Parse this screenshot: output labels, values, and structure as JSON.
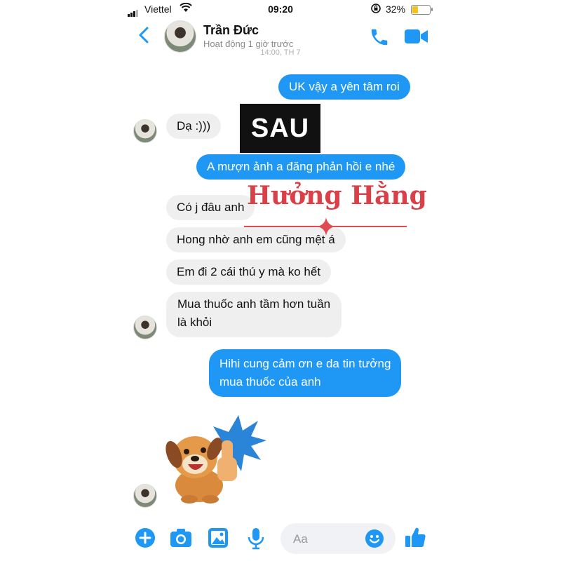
{
  "status_bar": {
    "carrier": "Viettel",
    "time": "09:20",
    "battery": "32%"
  },
  "header": {
    "contact_name": "Trần Đức",
    "contact_status": "Hoạt động 1 giờ trước",
    "timestamp": "14:00, TH 7"
  },
  "messages": [
    {
      "from": "me",
      "text": "UK vậy a yên tâm roi"
    },
    {
      "from": "them",
      "text": "Dạ :)))"
    },
    {
      "from": "me",
      "text": "A mượn ảnh a đăng phản hồi e nhé"
    },
    {
      "from": "them",
      "text": "Có j đâu anh"
    },
    {
      "from": "them",
      "text": "Hong nhờ anh em cũng mệt á"
    },
    {
      "from": "them",
      "text": "Em đi 2 cái thú y mà ko hết"
    },
    {
      "from": "them",
      "line1": "Mua thuốc anh tầm hơn tuần",
      "line2": "là khỏi"
    },
    {
      "from": "me",
      "line1": "Hihi cung cảm ơn e da tin tưởng",
      "line2": "mua thuốc của anh"
    }
  ],
  "overlay": {
    "label": "SAU",
    "watermark": "Hưởng Hằng"
  },
  "composer": {
    "placeholder": "Aa"
  },
  "colors": {
    "accent": "#1e97f5",
    "incoming": "#efefef",
    "watermark": "#d94048"
  },
  "icons": [
    "back-icon",
    "phone-icon",
    "video-camera-icon",
    "plus-icon",
    "camera-icon",
    "image-icon",
    "microphone-icon",
    "emoji-icon",
    "thumbs-up-icon",
    "dog-thumbs-up-sticker"
  ]
}
